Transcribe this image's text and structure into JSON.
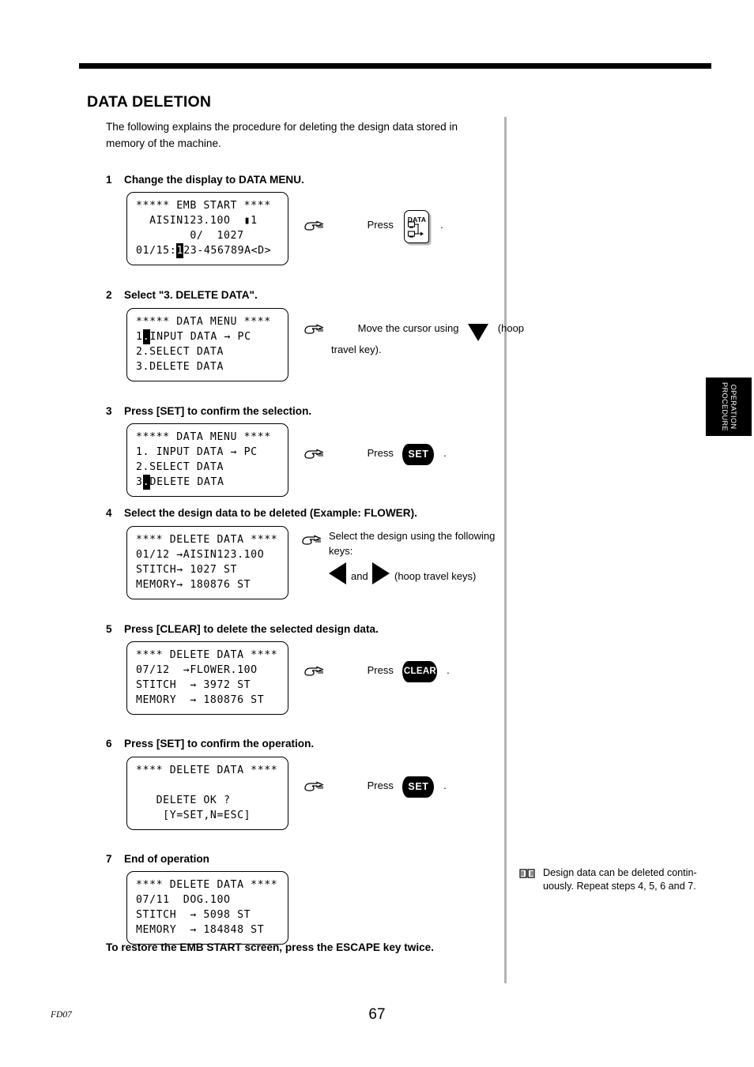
{
  "page": {
    "title": "DATA DELETION",
    "intro": "The following explains the procedure for deleting the design data stored in memory of the machine.",
    "closing": "To restore the EMB START screen, press the ESCAPE key twice.",
    "side_tab_line1": "OPERATION",
    "side_tab_line2": "PROCEDURE",
    "footer_code": "FD07",
    "footer_page": "67"
  },
  "steps": [
    {
      "num": "1",
      "head": "Change the display to DATA MENU.",
      "lcd": {
        "l1": "***** EMB START ****",
        "l2": "  AISIN123.10O  ▮1",
        "l3": "        0/  1027",
        "l4_pre": "01/15:",
        "l4_cursor": "1",
        "l4_post": "23-456789A<D>"
      },
      "instruction": {
        "press_label": "Press",
        "key": "DATA",
        "period": "."
      }
    },
    {
      "num": "2",
      "head": "Select \"3. DELETE DATA\".",
      "lcd": {
        "l1": "***** DATA MENU ****",
        "l2_pre": "1",
        "l2_cursor": ".",
        "l2_post": "INPUT DATA → PC",
        "l3": "2.SELECT DATA",
        "l4": "3.DELETE DATA"
      },
      "instruction": {
        "text_before": "Move the cursor using",
        "key": "down-triangle",
        "text_after_1": "(hoop",
        "text_after_2": "travel key)."
      }
    },
    {
      "num": "3",
      "head": "Press [SET] to confirm the selection.",
      "lcd": {
        "l1": "***** DATA MENU ****",
        "l2": "1. INPUT DATA → PC",
        "l3": "2.SELECT DATA",
        "l4_pre": "3",
        "l4_cursor": ".",
        "l4_post": "DELETE DATA"
      },
      "instruction": {
        "press_label": "Press",
        "key": "SET",
        "period": "."
      }
    },
    {
      "num": "4",
      "head": "Select the design data to be deleted (Example: FLOWER).",
      "lcd": {
        "l1": "**** DELETE DATA ****",
        "l2": "01/12 →AISIN123.10O",
        "l3": "STITCH→ 1027 ST",
        "l4": "MEMORY→ 180876 ST"
      },
      "instruction": {
        "text_line1": "Select the design using the following",
        "text_line2": "keys:",
        "and_label": "and",
        "trailing": "(hoop travel keys)"
      }
    },
    {
      "num": "5",
      "head": "Press [CLEAR] to delete the selected design data.",
      "lcd": {
        "l1": "**** DELETE DATA ****",
        "l2": "07/12  →FLOWER.10O",
        "l3": "STITCH  → 3972 ST",
        "l4": "MEMORY  → 180876 ST"
      },
      "instruction": {
        "press_label": "Press",
        "key": "CLEAR",
        "period": "."
      }
    },
    {
      "num": "6",
      "head": "Press [SET] to confirm the operation.",
      "lcd": {
        "l1": "**** DELETE DATA ****",
        "l2": "",
        "l3": "   DELETE OK ?",
        "l4": "    [Y=SET,N=ESC]"
      },
      "instruction": {
        "press_label": "Press",
        "key": "SET",
        "period": "."
      }
    },
    {
      "num": "7",
      "head": "End of operation",
      "lcd": {
        "l1": "**** DELETE DATA ****",
        "l2": "07/11  DOG.10O",
        "l3": "STITCH  → 5098 ST",
        "l4": "MEMORY  → 184848 ST"
      }
    }
  ],
  "note": {
    "icon": "book-icon",
    "line1": "Design data can be deleted contin-",
    "line2": "uously.  Repeat steps 4, 5, 6 and 7."
  }
}
